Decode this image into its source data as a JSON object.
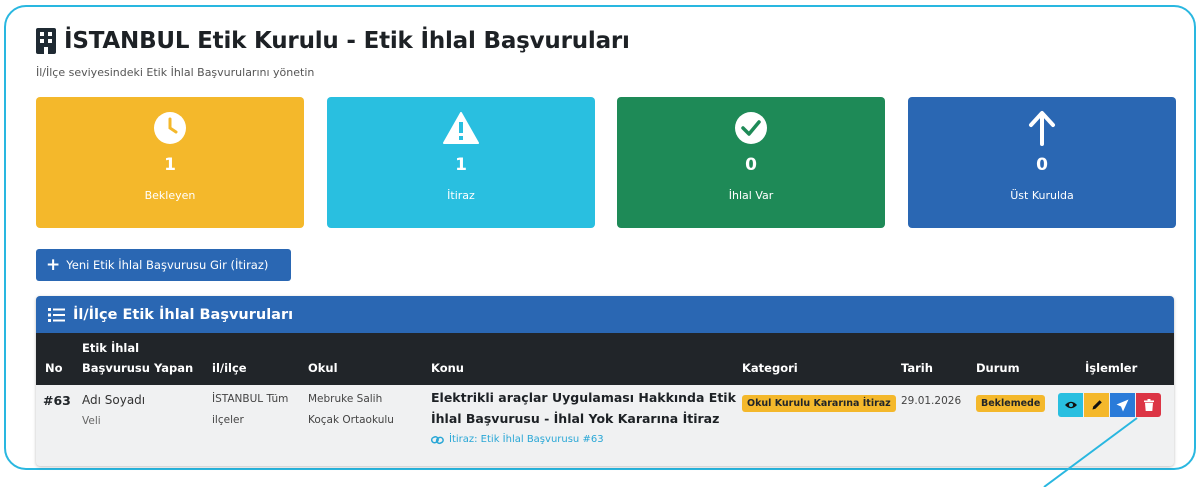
{
  "page": {
    "title": "İSTANBUL Etik Kurulu - Etik İhlal Başvuruları",
    "subtitle": "İl/İlçe seviyesindeki Etik İhlal Başvurularını yönetin"
  },
  "stats": [
    {
      "value": "1",
      "label": "Bekleyen",
      "color": "#f4b82b",
      "icon": "clock-icon"
    },
    {
      "value": "1",
      "label": "İtiraz",
      "color": "#29bfe0",
      "icon": "warning-icon"
    },
    {
      "value": "0",
      "label": "İhlal Var",
      "color": "#1e8a57",
      "icon": "check-circle-icon"
    },
    {
      "value": "0",
      "label": "Üst Kurulda",
      "color": "#2a67b3",
      "icon": "arrow-up-icon"
    }
  ],
  "new_button": {
    "label": "Yeni Etik İhlal Başvurusu Gir (İtiraz)",
    "icon": "plus-icon"
  },
  "panel": {
    "title": "İl/İlçe Etik İhlal Başvuruları",
    "icon": "list-icon",
    "columns": {
      "no": "No",
      "applicant_line1": "Etik İhlal",
      "applicant_line2": "Başvurusu Yapan",
      "district": "il/ilçe",
      "school": "Okul",
      "subject": "Konu",
      "category": "Kategori",
      "date": "Tarih",
      "status": "Durum",
      "actions": "İşlemler"
    },
    "rows": [
      {
        "no": "#63",
        "applicant_name": "Adı Soyadı",
        "applicant_role": "Veli",
        "district_line1": "İSTANBUL Tüm",
        "district_line2": "ilçeler",
        "school_line1": "Mebruke Salih",
        "school_line2": "Koçak Ortaokulu",
        "subject_line1": "Elektrikli araçlar Uygulaması Hakkında Etik",
        "subject_line2": "İhlal Başvurusu - İhlal Yok Kararına İtiraz",
        "subject_link": "İtiraz: Etik İhlal Başvurusu #63",
        "category": "Okul Kurulu Kararına İtiraz",
        "date": "29.01.2026",
        "status": "Beklemede",
        "actions": [
          {
            "name": "view",
            "icon": "eye-icon",
            "color": "#29bfe0"
          },
          {
            "name": "edit",
            "icon": "pencil-icon",
            "color": "#f4b82b"
          },
          {
            "name": "send",
            "icon": "send-icon",
            "color": "#2a7bd9"
          },
          {
            "name": "delete",
            "icon": "trash-icon",
            "color": "#dc3545"
          }
        ]
      }
    ]
  },
  "colors": {
    "accent": "#2a67b3",
    "highlight": "#29b7e0",
    "dark_header": "#212529"
  }
}
